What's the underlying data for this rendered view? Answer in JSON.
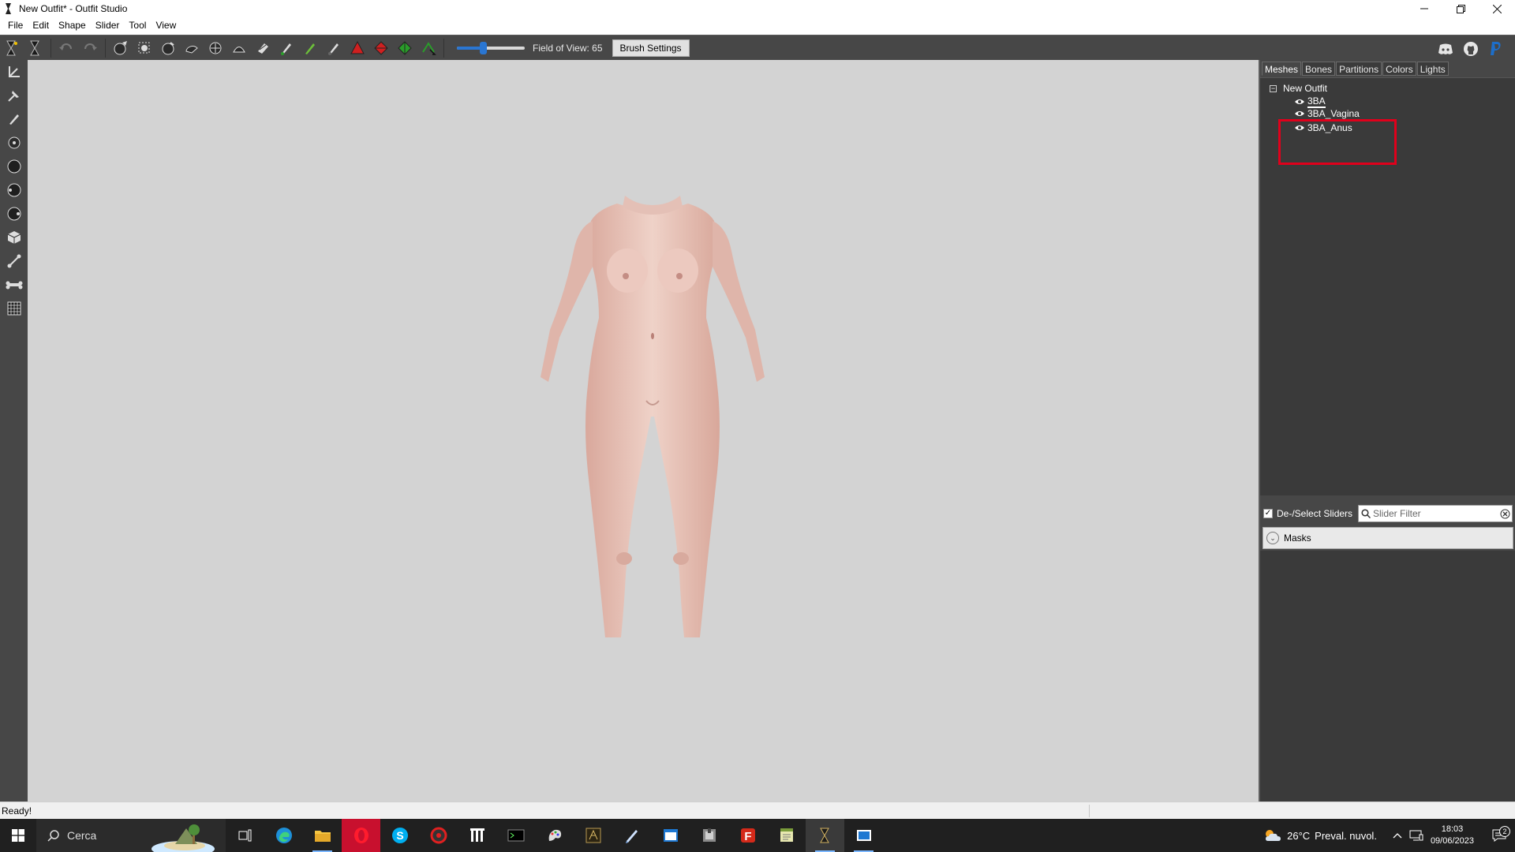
{
  "window": {
    "title": "New Outfit* - Outfit Studio",
    "controls": [
      "minimize",
      "restore",
      "close"
    ]
  },
  "menu": {
    "items": [
      "File",
      "Edit",
      "Shape",
      "Slider",
      "Tool",
      "View"
    ]
  },
  "toolbar": {
    "fov_label": "Field of View: 65",
    "fov_slider_level_percent": 38,
    "brush_settings_label": "Brush Settings"
  },
  "right_panel": {
    "tabs": [
      "Meshes",
      "Bones",
      "Partitions",
      "Colors",
      "Lights"
    ],
    "active_tab": "Meshes",
    "tree": {
      "root": "New Outfit",
      "items": [
        {
          "label": "3BA",
          "selected": true
        },
        {
          "label": "3BA_Vagina",
          "selected": false
        },
        {
          "label": "3BA_Anus",
          "selected": false
        }
      ]
    },
    "deselect_sliders_label": "De-/Select Sliders",
    "deselect_sliders_checked": true,
    "slider_filter_placeholder": "Slider Filter",
    "masks_label": "Masks"
  },
  "status": {
    "text": "Ready!"
  },
  "taskbar": {
    "search_text": "Cerca",
    "weather_temp": "26°C",
    "weather_desc": "Preval. nuvol.",
    "time": "18:03",
    "date": "09/06/2023",
    "notification_count": "2"
  },
  "colors": {
    "toolbar_bg": "#474747",
    "viewport_bg": "#d3d3d3",
    "accent_blue": "#2a76d2",
    "highlight_red": "#e0001b"
  }
}
